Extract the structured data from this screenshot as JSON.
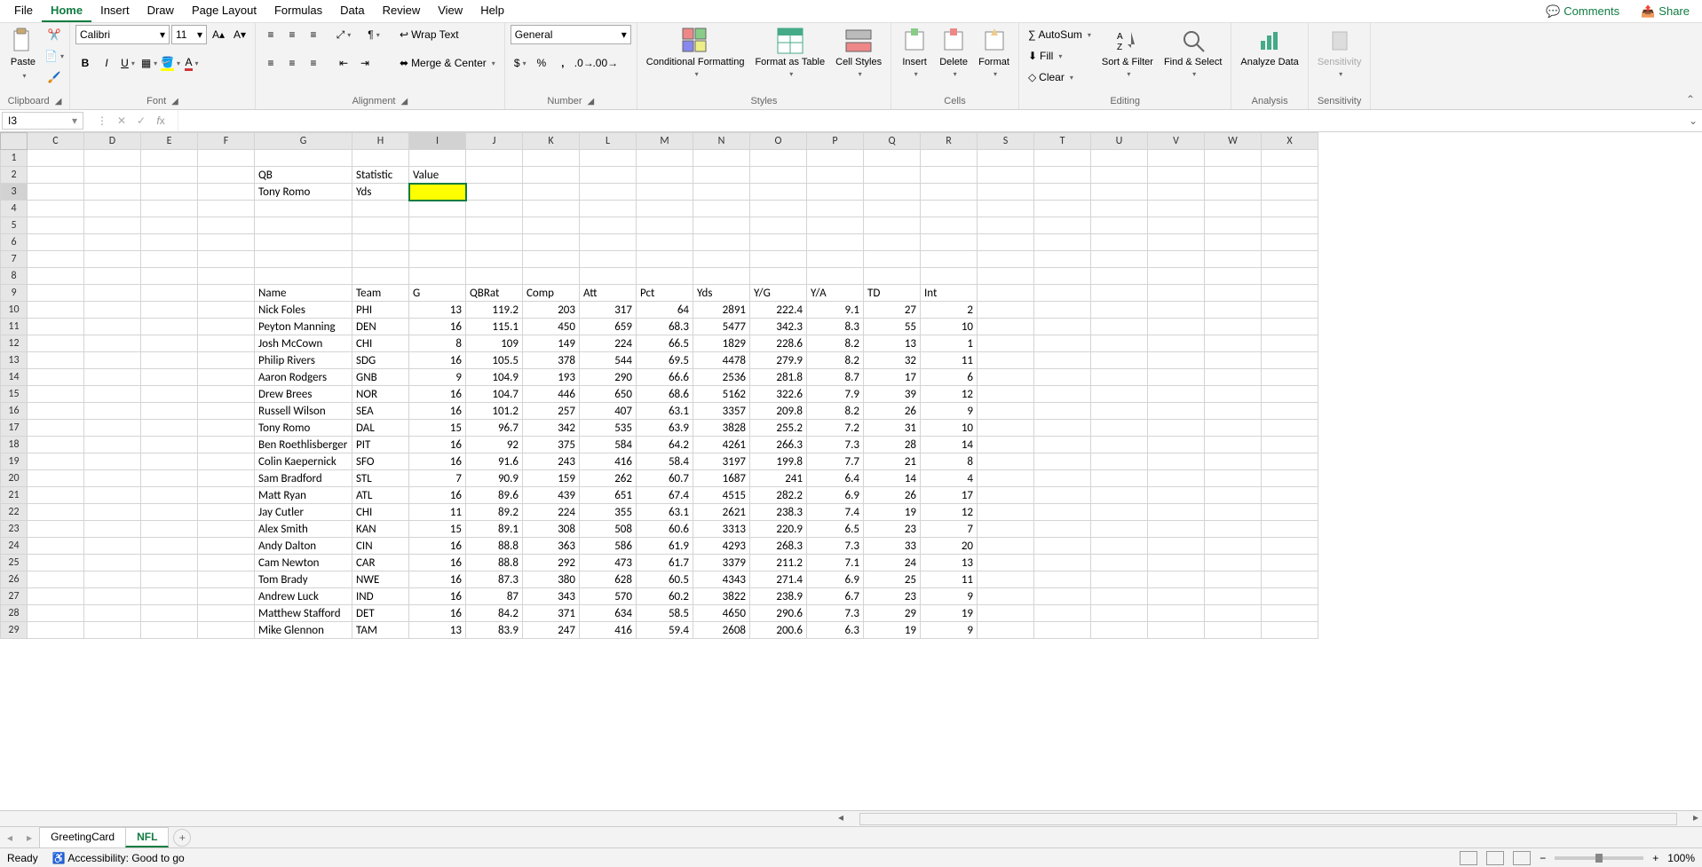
{
  "menu": {
    "items": [
      "File",
      "Home",
      "Insert",
      "Draw",
      "Page Layout",
      "Formulas",
      "Data",
      "Review",
      "View",
      "Help"
    ],
    "active": "Home",
    "comments": "Comments",
    "share": "Share"
  },
  "ribbon": {
    "clipboard": {
      "paste": "Paste",
      "label": "Clipboard"
    },
    "font": {
      "name": "Calibri",
      "size": "11",
      "label": "Font"
    },
    "alignment": {
      "wrap": "Wrap Text",
      "merge": "Merge & Center",
      "label": "Alignment"
    },
    "number": {
      "format": "General",
      "label": "Number"
    },
    "styles": {
      "cf": "Conditional Formatting",
      "fat": "Format as Table",
      "cs": "Cell Styles",
      "label": "Styles"
    },
    "cells": {
      "insert": "Insert",
      "delete": "Delete",
      "format": "Format",
      "label": "Cells"
    },
    "editing": {
      "autosum": "AutoSum",
      "fill": "Fill",
      "clear": "Clear",
      "sort": "Sort & Filter",
      "find": "Find & Select",
      "label": "Editing"
    },
    "analysis": {
      "analyze": "Analyze Data",
      "label": "Analysis"
    },
    "sensitivity": {
      "btn": "Sensitivity",
      "label": "Sensitivity"
    }
  },
  "nameBox": "I3",
  "formula": "",
  "columns": [
    "C",
    "D",
    "E",
    "F",
    "G",
    "H",
    "I",
    "J",
    "K",
    "L",
    "M",
    "N",
    "O",
    "P",
    "Q",
    "R",
    "S",
    "T",
    "U",
    "V",
    "W",
    "X"
  ],
  "colWidths": {
    "G": 110,
    "H": 64,
    "I": 64,
    "default": 64
  },
  "rows": 29,
  "selectedCell": {
    "col": "I",
    "row": 3
  },
  "cells": {
    "G2": "QB",
    "H2": "Statistic",
    "I2": "Value",
    "G3": "Tony Romo",
    "H3": "Yds",
    "G9": "Name",
    "H9": "Team",
    "I9": "G",
    "J9": "QBRat",
    "K9": "Comp",
    "L9": "Att",
    "M9": "Pct",
    "N9": "Yds",
    "O9": "Y/G",
    "P9": "Y/A",
    "Q9": "TD",
    "R9": "Int"
  },
  "tableRows": [
    {
      "r": 10,
      "Name": "Nick Foles",
      "Team": "PHI",
      "G": 13,
      "QBRat": 119.2,
      "Comp": 203,
      "Att": 317,
      "Pct": 64,
      "Yds": 2891,
      "YG": 222.4,
      "YA": 9.1,
      "TD": 27,
      "Int": 2
    },
    {
      "r": 11,
      "Name": "Peyton Manning",
      "Team": "DEN",
      "G": 16,
      "QBRat": 115.1,
      "Comp": 450,
      "Att": 659,
      "Pct": 68.3,
      "Yds": 5477,
      "YG": 342.3,
      "YA": 8.3,
      "TD": 55,
      "Int": 10
    },
    {
      "r": 12,
      "Name": "Josh McCown",
      "Team": "CHI",
      "G": 8,
      "QBRat": 109,
      "Comp": 149,
      "Att": 224,
      "Pct": 66.5,
      "Yds": 1829,
      "YG": 228.6,
      "YA": 8.2,
      "TD": 13,
      "Int": 1
    },
    {
      "r": 13,
      "Name": "Philip Rivers",
      "Team": "SDG",
      "G": 16,
      "QBRat": 105.5,
      "Comp": 378,
      "Att": 544,
      "Pct": 69.5,
      "Yds": 4478,
      "YG": 279.9,
      "YA": 8.2,
      "TD": 32,
      "Int": 11
    },
    {
      "r": 14,
      "Name": "Aaron Rodgers",
      "Team": "GNB",
      "G": 9,
      "QBRat": 104.9,
      "Comp": 193,
      "Att": 290,
      "Pct": 66.6,
      "Yds": 2536,
      "YG": 281.8,
      "YA": 8.7,
      "TD": 17,
      "Int": 6
    },
    {
      "r": 15,
      "Name": "Drew Brees",
      "Team": "NOR",
      "G": 16,
      "QBRat": 104.7,
      "Comp": 446,
      "Att": 650,
      "Pct": 68.6,
      "Yds": 5162,
      "YG": 322.6,
      "YA": 7.9,
      "TD": 39,
      "Int": 12
    },
    {
      "r": 16,
      "Name": "Russell Wilson",
      "Team": "SEA",
      "G": 16,
      "QBRat": 101.2,
      "Comp": 257,
      "Att": 407,
      "Pct": 63.1,
      "Yds": 3357,
      "YG": 209.8,
      "YA": 8.2,
      "TD": 26,
      "Int": 9
    },
    {
      "r": 17,
      "Name": "Tony Romo",
      "Team": "DAL",
      "G": 15,
      "QBRat": 96.7,
      "Comp": 342,
      "Att": 535,
      "Pct": 63.9,
      "Yds": 3828,
      "YG": 255.2,
      "YA": 7.2,
      "TD": 31,
      "Int": 10
    },
    {
      "r": 18,
      "Name": "Ben Roethlisberger",
      "Team": "PIT",
      "G": 16,
      "QBRat": 92,
      "Comp": 375,
      "Att": 584,
      "Pct": 64.2,
      "Yds": 4261,
      "YG": 266.3,
      "YA": 7.3,
      "TD": 28,
      "Int": 14
    },
    {
      "r": 19,
      "Name": "Colin Kaepernick",
      "Team": "SFO",
      "G": 16,
      "QBRat": 91.6,
      "Comp": 243,
      "Att": 416,
      "Pct": 58.4,
      "Yds": 3197,
      "YG": 199.8,
      "YA": 7.7,
      "TD": 21,
      "Int": 8
    },
    {
      "r": 20,
      "Name": "Sam Bradford",
      "Team": "STL",
      "G": 7,
      "QBRat": 90.9,
      "Comp": 159,
      "Att": 262,
      "Pct": 60.7,
      "Yds": 1687,
      "YG": 241,
      "YA": 6.4,
      "TD": 14,
      "Int": 4
    },
    {
      "r": 21,
      "Name": "Matt Ryan",
      "Team": "ATL",
      "G": 16,
      "QBRat": 89.6,
      "Comp": 439,
      "Att": 651,
      "Pct": 67.4,
      "Yds": 4515,
      "YG": 282.2,
      "YA": 6.9,
      "TD": 26,
      "Int": 17
    },
    {
      "r": 22,
      "Name": "Jay Cutler",
      "Team": "CHI",
      "G": 11,
      "QBRat": 89.2,
      "Comp": 224,
      "Att": 355,
      "Pct": 63.1,
      "Yds": 2621,
      "YG": 238.3,
      "YA": 7.4,
      "TD": 19,
      "Int": 12
    },
    {
      "r": 23,
      "Name": "Alex Smith",
      "Team": "KAN",
      "G": 15,
      "QBRat": 89.1,
      "Comp": 308,
      "Att": 508,
      "Pct": 60.6,
      "Yds": 3313,
      "YG": 220.9,
      "YA": 6.5,
      "TD": 23,
      "Int": 7
    },
    {
      "r": 24,
      "Name": "Andy Dalton",
      "Team": "CIN",
      "G": 16,
      "QBRat": 88.8,
      "Comp": 363,
      "Att": 586,
      "Pct": 61.9,
      "Yds": 4293,
      "YG": 268.3,
      "YA": 7.3,
      "TD": 33,
      "Int": 20
    },
    {
      "r": 25,
      "Name": "Cam Newton",
      "Team": "CAR",
      "G": 16,
      "QBRat": 88.8,
      "Comp": 292,
      "Att": 473,
      "Pct": 61.7,
      "Yds": 3379,
      "YG": 211.2,
      "YA": 7.1,
      "TD": 24,
      "Int": 13
    },
    {
      "r": 26,
      "Name": "Tom Brady",
      "Team": "NWE",
      "G": 16,
      "QBRat": 87.3,
      "Comp": 380,
      "Att": 628,
      "Pct": 60.5,
      "Yds": 4343,
      "YG": 271.4,
      "YA": 6.9,
      "TD": 25,
      "Int": 11
    },
    {
      "r": 27,
      "Name": "Andrew Luck",
      "Team": "IND",
      "G": 16,
      "QBRat": 87,
      "Comp": 343,
      "Att": 570,
      "Pct": 60.2,
      "Yds": 3822,
      "YG": 238.9,
      "YA": 6.7,
      "TD": 23,
      "Int": 9
    },
    {
      "r": 28,
      "Name": "Matthew Stafford",
      "Team": "DET",
      "G": 16,
      "QBRat": 84.2,
      "Comp": 371,
      "Att": 634,
      "Pct": 58.5,
      "Yds": 4650,
      "YG": 290.6,
      "YA": 7.3,
      "TD": 29,
      "Int": 19
    },
    {
      "r": 29,
      "Name": "Mike Glennon",
      "Team": "TAM",
      "G": 13,
      "QBRat": 83.9,
      "Comp": 247,
      "Att": 416,
      "Pct": 59.4,
      "Yds": 2608,
      "YG": 200.6,
      "YA": 6.3,
      "TD": 19,
      "Int": 9
    }
  ],
  "tableColMap": {
    "Name": "G",
    "Team": "H",
    "G": "I",
    "QBRat": "J",
    "Comp": "K",
    "Att": "L",
    "Pct": "M",
    "Yds": "N",
    "YG": "O",
    "YA": "P",
    "TD": "Q",
    "Int": "R"
  },
  "numericCols": [
    "I",
    "J",
    "K",
    "L",
    "M",
    "N",
    "O",
    "P",
    "Q",
    "R"
  ],
  "sheets": {
    "tabs": [
      "GreetingCard",
      "NFL"
    ],
    "active": "NFL"
  },
  "status": {
    "ready": "Ready",
    "access": "Accessibility: Good to go",
    "zoom": "100%"
  }
}
